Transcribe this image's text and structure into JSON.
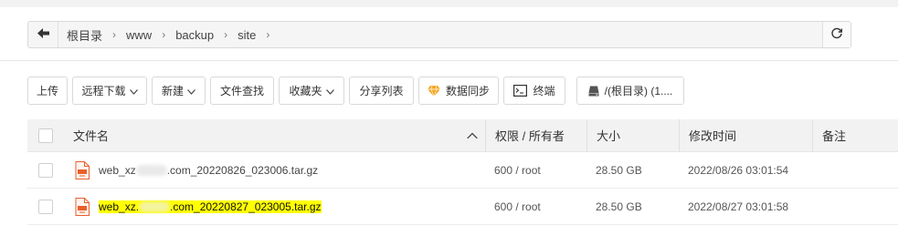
{
  "path": {
    "crumbs": [
      "根目录",
      "www",
      "backup",
      "site"
    ]
  },
  "toolbar": {
    "upload": "上传",
    "remote_download": "远程下载",
    "new": "新建",
    "file_search": "文件查找",
    "favorites": "收藏夹",
    "share_list": "分享列表",
    "data_sync": "数据同步",
    "terminal": "终端",
    "disk": "/(根目录) (1...."
  },
  "table": {
    "headers": {
      "name": "文件名",
      "perm": "权限 / 所有者",
      "size": "大小",
      "mtime": "修改时间",
      "note": "备注"
    },
    "rows": [
      {
        "name_prefix": "web_xz",
        "name_suffix": ".com_20220826_023006.tar.gz",
        "perm": "600 / root",
        "size": "28.50 GB",
        "mtime": "2022/08/26 03:01:54",
        "note": "",
        "highlighted": false
      },
      {
        "name_prefix": "web_xz.",
        "name_suffix": ".com_20220827_023005.tar.gz",
        "perm": "600 / root",
        "size": "28.50 GB",
        "mtime": "2022/08/27 03:01:58",
        "note": "",
        "highlighted": true
      }
    ]
  },
  "colors": {
    "highlight": "#ffff00",
    "sync_icon": "#f5a623",
    "file_icon": "#e8602c"
  }
}
